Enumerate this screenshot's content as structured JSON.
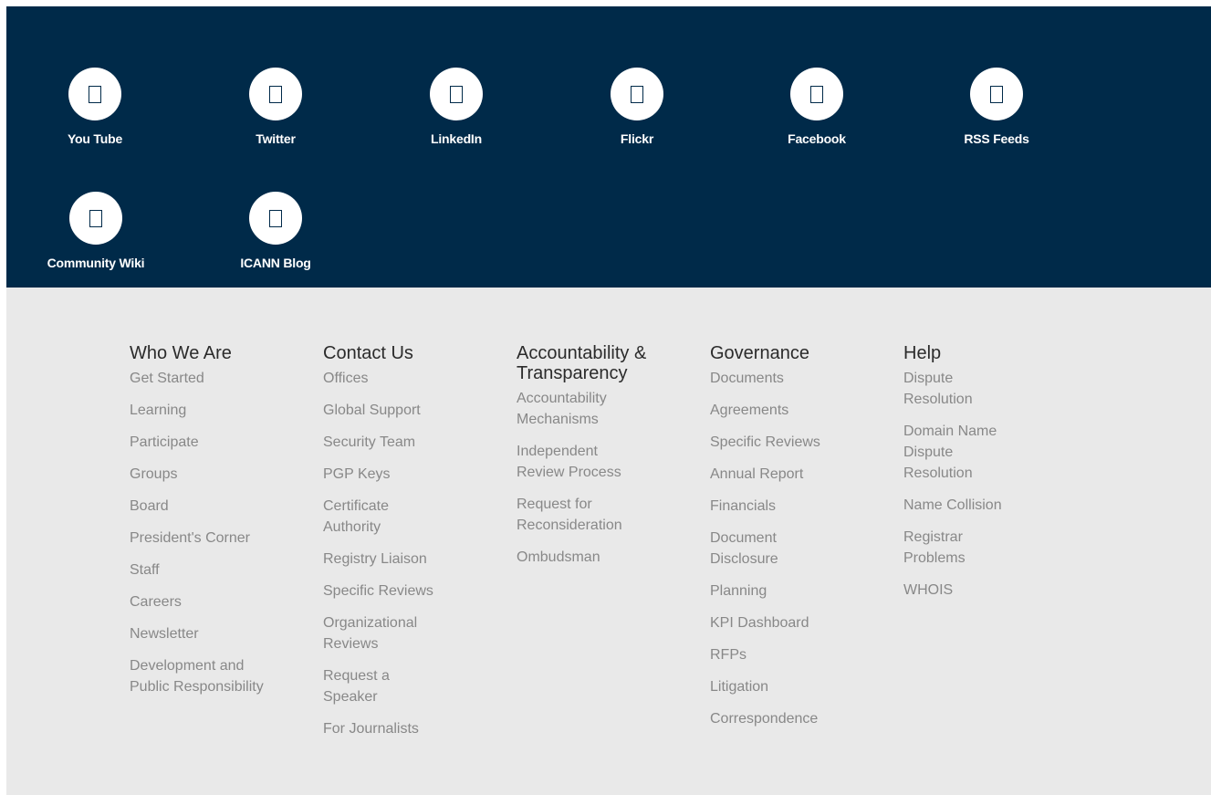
{
  "social": {
    "items": [
      {
        "label": "You Tube",
        "icon": "youtube-icon"
      },
      {
        "label": "Twitter",
        "icon": "twitter-icon"
      },
      {
        "label": "LinkedIn",
        "icon": "linkedin-icon"
      },
      {
        "label": "Flickr",
        "icon": "flickr-icon"
      },
      {
        "label": "Facebook",
        "icon": "facebook-icon"
      },
      {
        "label": "RSS Feeds",
        "icon": "rss-icon"
      },
      {
        "label": "Community Wiki",
        "icon": "wiki-icon"
      },
      {
        "label": "ICANN Blog",
        "icon": "blog-icon"
      }
    ]
  },
  "footer": {
    "columns": [
      {
        "title": "Who We Are",
        "links": [
          "Get Started",
          "Learning",
          "Participate",
          "Groups",
          "Board",
          "President's Corner",
          "Staff",
          "Careers",
          "Newsletter",
          "Development and Public Responsibility"
        ]
      },
      {
        "title": "Contact Us",
        "links": [
          "Offices",
          "Global Support",
          "Security Team",
          "PGP Keys",
          "Certificate Authority",
          "Registry Liaison",
          "Specific Reviews",
          "Organizational Reviews",
          "Request a Speaker",
          "For Journalists"
        ]
      },
      {
        "title": "Accountability & Transparency",
        "links": [
          "Accountability Mechanisms",
          "Independent Review Process",
          "Request for Reconsideration",
          "Ombudsman"
        ]
      },
      {
        "title": "Governance",
        "links": [
          "Documents",
          "Agreements",
          "Specific Reviews",
          "Annual Report",
          "Financials",
          "Document Disclosure",
          "Planning",
          "KPI Dashboard",
          "RFPs",
          "Litigation",
          "Correspondence"
        ]
      },
      {
        "title": "Help",
        "links": [
          "Dispute Resolution",
          "Domain Name Dispute Resolution",
          "Name Collision",
          "Registrar Problems",
          "WHOIS"
        ]
      }
    ]
  },
  "colors": {
    "social_bg": "#002a49",
    "footer_bg": "#e9e9e9",
    "heading": "#2b2b2b",
    "link": "#888888"
  }
}
